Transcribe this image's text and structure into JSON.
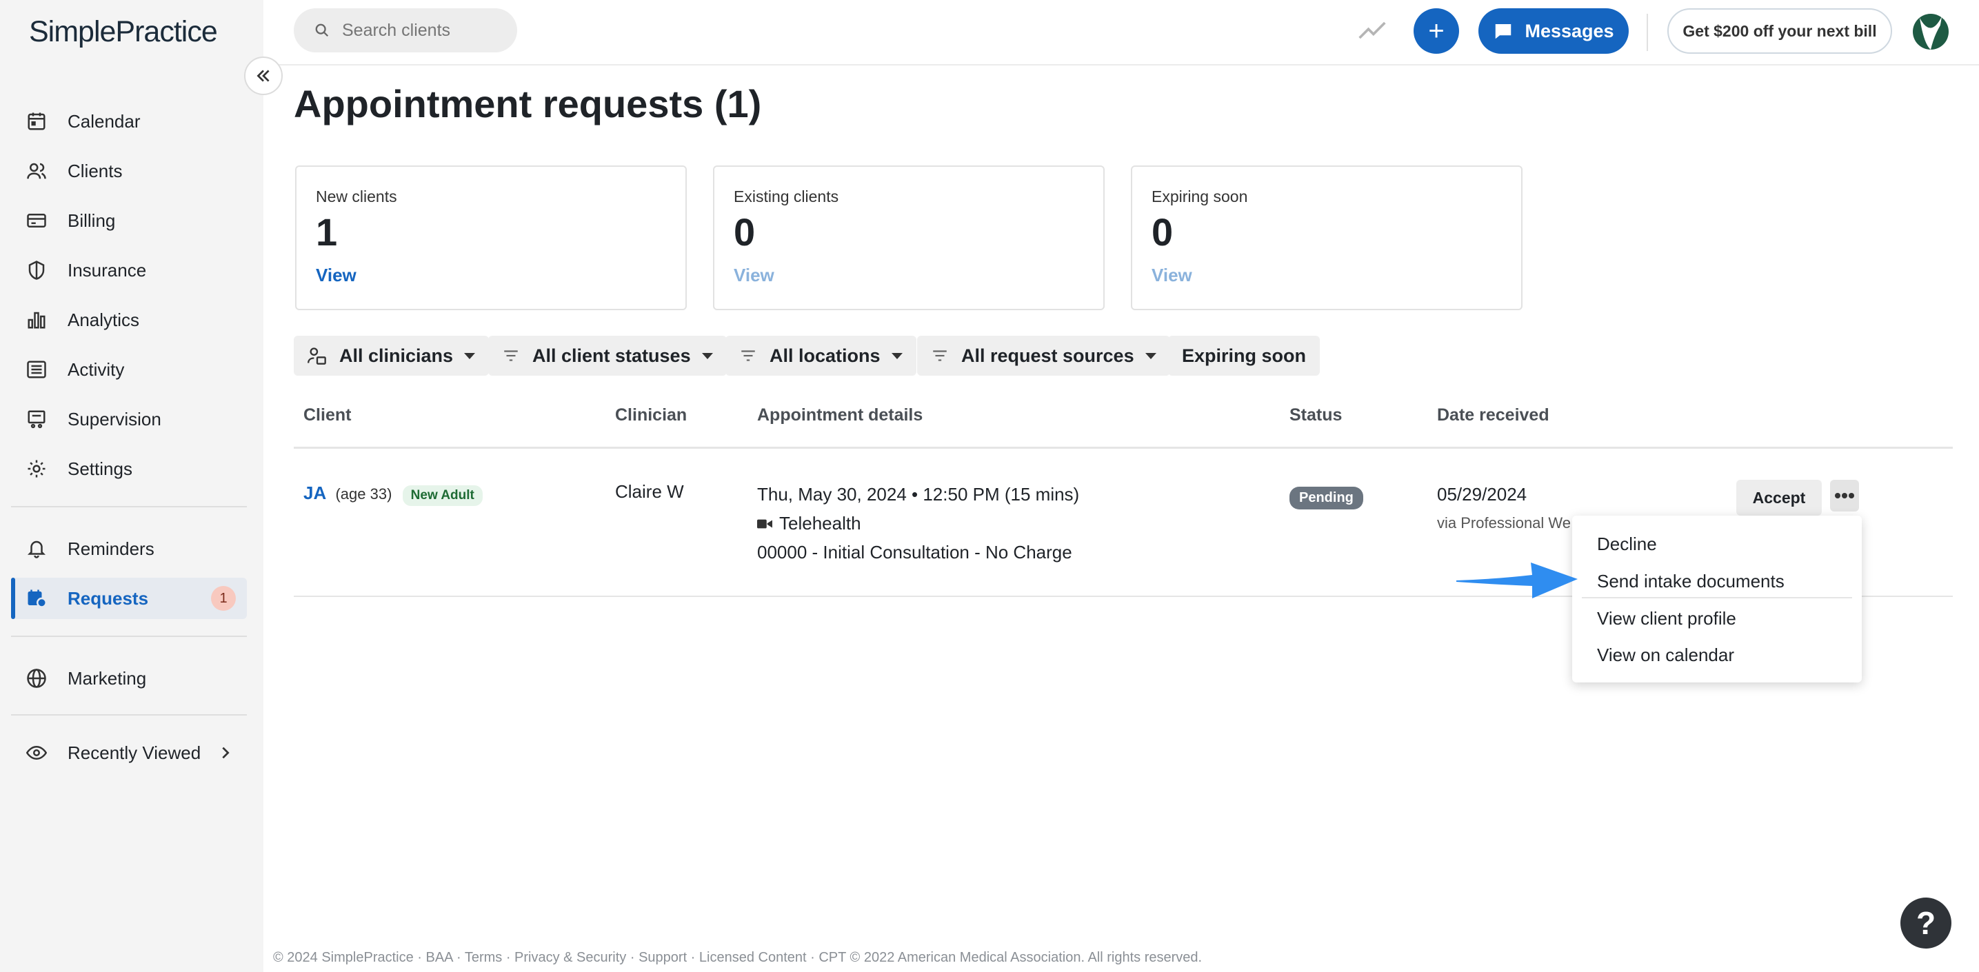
{
  "app": {
    "logo_text": "SimplePractice"
  },
  "sidebar": {
    "items": [
      {
        "label": "Calendar",
        "icon": "calendar-icon"
      },
      {
        "label": "Clients",
        "icon": "users-icon"
      },
      {
        "label": "Billing",
        "icon": "credit-card-icon"
      },
      {
        "label": "Insurance",
        "icon": "shield-icon"
      },
      {
        "label": "Analytics",
        "icon": "bar-chart-icon"
      },
      {
        "label": "Activity",
        "icon": "list-icon"
      },
      {
        "label": "Supervision",
        "icon": "supervision-icon"
      },
      {
        "label": "Settings",
        "icon": "gear-icon"
      },
      {
        "label": "Reminders",
        "icon": "bell-icon"
      },
      {
        "label": "Requests",
        "icon": "calendar-request-icon",
        "badge": "1",
        "active": true
      },
      {
        "label": "Marketing",
        "icon": "globe-icon"
      },
      {
        "label": "Recently Viewed",
        "icon": "eye-icon"
      }
    ]
  },
  "topbar": {
    "search_placeholder": "Search clients",
    "messages_label": "Messages",
    "promo_label": "Get $200 off your next bill"
  },
  "main": {
    "title": "Appointment requests (1)",
    "cards": [
      {
        "label": "New clients",
        "value": "1",
        "link": "View"
      },
      {
        "label": "Existing clients",
        "value": "0",
        "link": "View"
      },
      {
        "label": "Expiring soon",
        "value": "0",
        "link": "View"
      }
    ],
    "filters": [
      "All clinicians",
      "All client statuses",
      "All locations",
      "All request sources",
      "Expiring soon"
    ],
    "table": {
      "headers": [
        "Client",
        "Clinician",
        "Appointment details",
        "Status",
        "Date received"
      ],
      "rows": [
        {
          "client_initials": "JA",
          "client_age": "(age 33)",
          "client_tag": "New Adult",
          "clinician": "Claire W",
          "appt_datetime": "Thu, May 30, 2024 • 12:50 PM (15 mins)",
          "appt_location": "Telehealth",
          "appt_service": "00000 - Initial Consultation - No Charge",
          "status": "Pending",
          "date_received": "05/29/2024",
          "source": "via Professional We",
          "accept_label": "Accept"
        }
      ]
    },
    "dropdown": {
      "items": [
        "Decline",
        "Send intake documents",
        "View client profile",
        "View on calendar"
      ]
    }
  },
  "footer": {
    "text": "© 2024 SimplePractice · BAA · Terms · Privacy & Security · Support · Licensed Content · CPT © 2022 American Medical Association. All rights reserved."
  },
  "colors": {
    "accent": "#1565c0",
    "arrow": "#2f8df0"
  }
}
